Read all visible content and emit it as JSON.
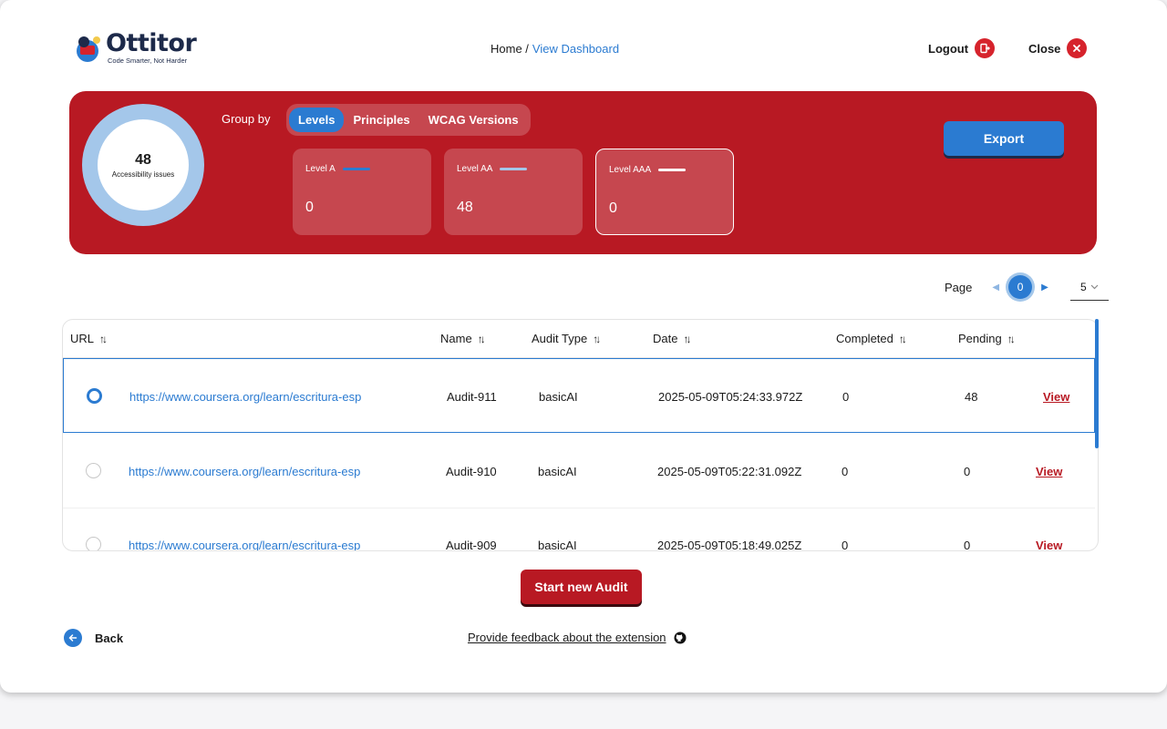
{
  "header": {
    "brand": "Ottitor",
    "tagline": "Code Smarter, Not Harder",
    "breadcrumb": {
      "home": "Home /",
      "current": "View Dashboard"
    },
    "logout_label": "Logout",
    "close_label": "Close"
  },
  "summary": {
    "total": "48",
    "total_label": "Accessibility issues",
    "group_by_label": "Group by",
    "group_options": [
      "Levels",
      "Principles",
      "WCAG Versions"
    ],
    "active_group": "Levels",
    "levels": [
      {
        "name": "Level A",
        "value": "0",
        "color": "#2b7bd1"
      },
      {
        "name": "Level AA",
        "value": "48",
        "color": "#a4c7ea"
      },
      {
        "name": "Level AAA",
        "value": "0",
        "color": "#ffffff"
      }
    ],
    "export_label": "Export"
  },
  "pagination": {
    "label": "Page",
    "current": "0",
    "page_size": "5"
  },
  "table": {
    "columns": [
      "URL",
      "Name",
      "Audit Type",
      "Date",
      "Completed",
      "Pending"
    ],
    "rows": [
      {
        "url": "https://www.coursera.org/learn/escritura-esp",
        "name": "Audit-911",
        "type": "basicAI",
        "date": "2025-05-09T05:24:33.972Z",
        "completed": "0",
        "pending": "48",
        "action": "View",
        "selected": true
      },
      {
        "url": "https://www.coursera.org/learn/escritura-esp",
        "name": "Audit-910",
        "type": "basicAI",
        "date": "2025-05-09T05:22:31.092Z",
        "completed": "0",
        "pending": "0",
        "action": "View",
        "selected": false
      },
      {
        "url": "https://www.coursera.org/learn/escritura-esp",
        "name": "Audit-909",
        "type": "basicAI",
        "date": "2025-05-09T05:18:49.025Z",
        "completed": "0",
        "pending": "0",
        "action": "View",
        "selected": false
      }
    ]
  },
  "footer": {
    "start_label": "Start new Audit",
    "back_label": "Back",
    "feedback_label": "Provide feedback about the extension"
  },
  "colors": {
    "brand_red": "#b81923",
    "accent_blue": "#2b7bd1",
    "light_blue": "#a4c7ea"
  }
}
